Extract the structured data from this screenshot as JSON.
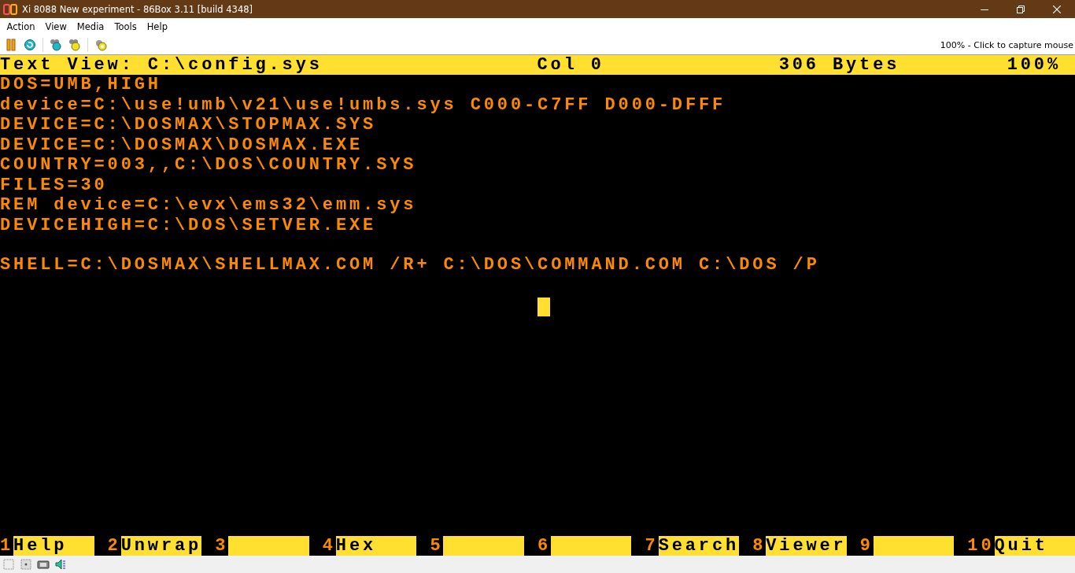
{
  "window": {
    "title": "Xi 8088 New experiment - 86Box 3.11 [build 4348]"
  },
  "menu": [
    "Action",
    "View",
    "Media",
    "Tools",
    "Help"
  ],
  "toolbar": {
    "status": "100% - Click to capture mouse"
  },
  "screen": {
    "header": {
      "title": "Text View: C:\\config.sys",
      "column": "Col 0",
      "size": "306 Bytes",
      "percent": "100%"
    },
    "paragraphs": [
      [
        "DOS=UMB,HIGH",
        "device=C:\\use!umb\\v21\\use!umbs.sys C000-C7FF D000-DFFF",
        "DEVICE=C:\\DOSMAX\\STOPMAX.SYS",
        "DEVICE=C:\\DOSMAX\\DOSMAX.EXE",
        "COUNTRY=003,,C:\\DOS\\COUNTRY.SYS",
        "FILES=30",
        "REM device=C:\\evx\\ems32\\emm.sys",
        "DEVICEHIGH=C:\\DOS\\SETVER.EXE"
      ],
      [
        "SHELL=C:\\DOSMAX\\SHELLMAX.COM /R+ C:\\DOS\\COMMAND.COM C:\\DOS /P"
      ]
    ],
    "function_keys": [
      {
        "number": "1",
        "label": "Help"
      },
      {
        "number": "2",
        "label": "Unwrap"
      },
      {
        "number": "3"
      },
      {
        "number": "4",
        "label": "Hex"
      },
      {
        "number": "5"
      },
      {
        "number": "6"
      },
      {
        "number": "7",
        "label": "Search"
      },
      {
        "number": "8",
        "label": "Viewer"
      },
      {
        "number": "9"
      },
      {
        "number": "10",
        "label": "Quit"
      }
    ]
  }
}
